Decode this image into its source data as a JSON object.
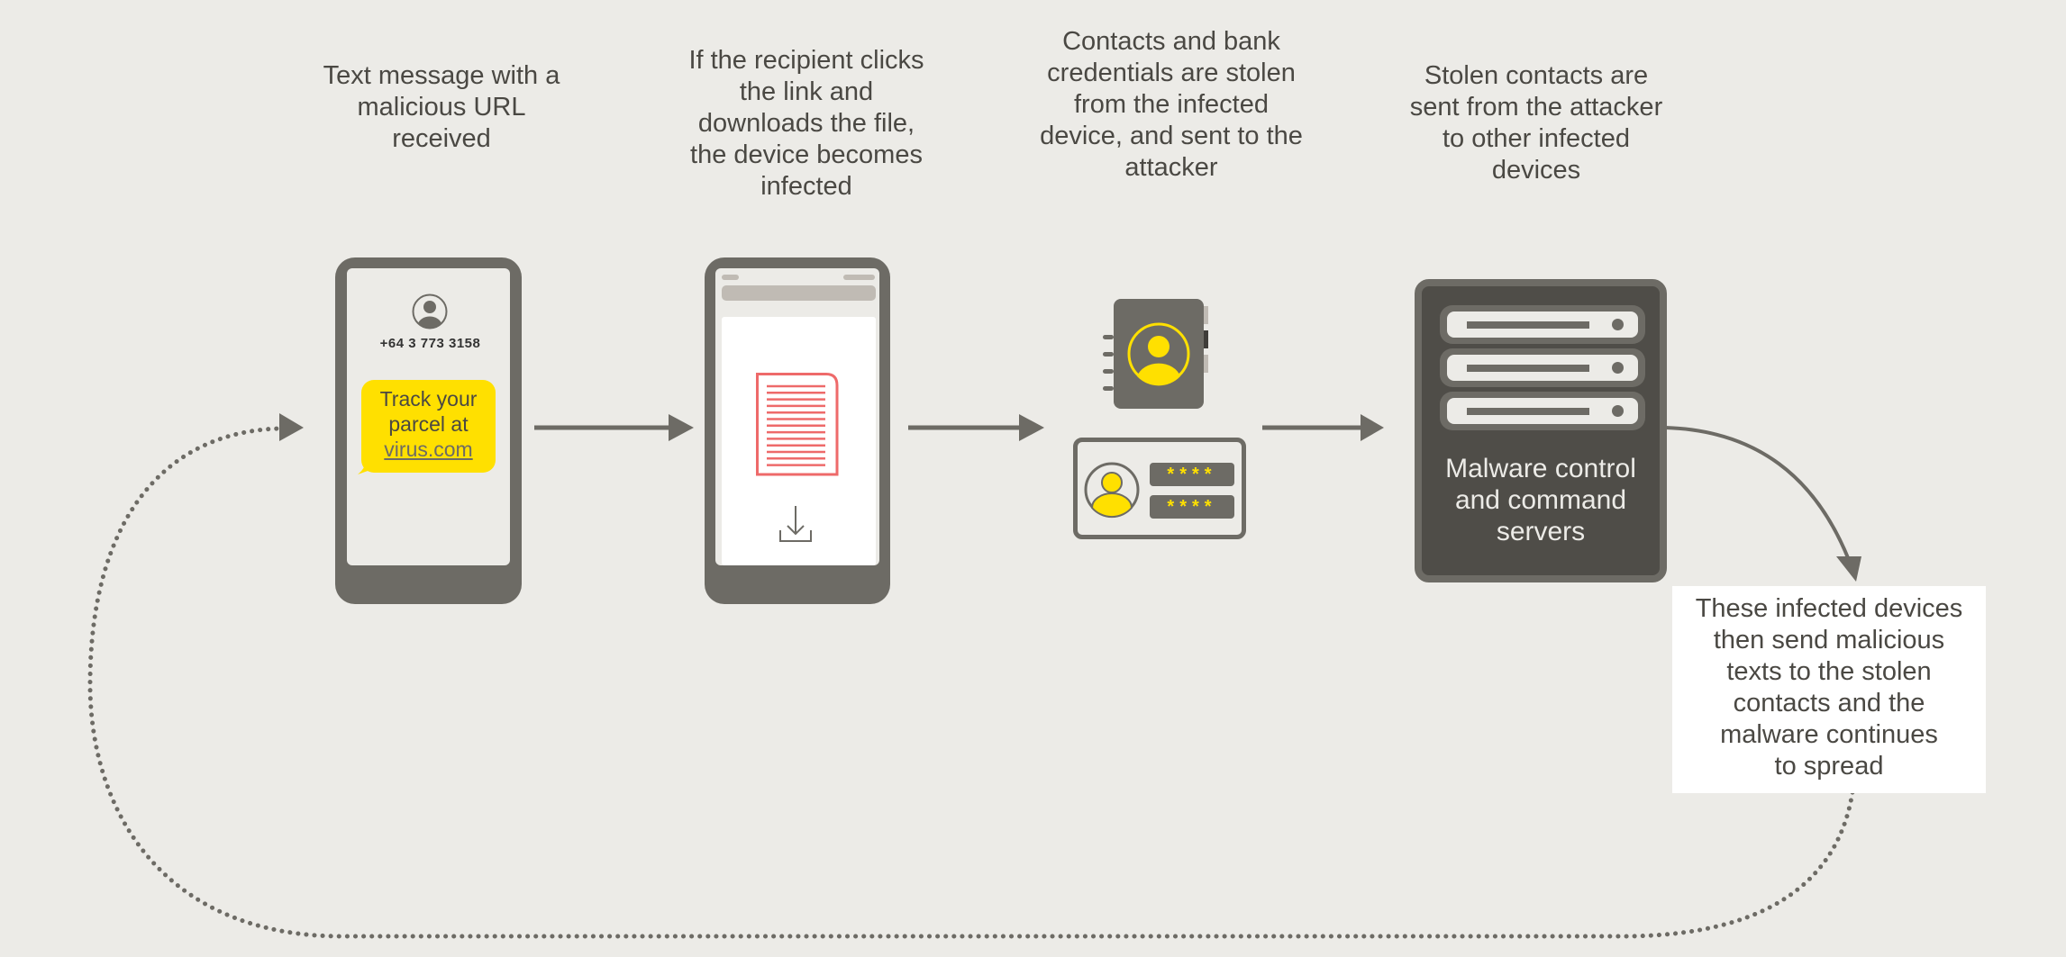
{
  "colors": {
    "background": "#ecebe7",
    "device_gray": "#6d6b65",
    "server_dark": "#4f4d48",
    "highlight_yellow": "#ffe000",
    "document_red": "#ee6a6a",
    "text": "#4a4843"
  },
  "steps": [
    {
      "caption": "Text message with a\nmalicious URL\nreceived"
    },
    {
      "caption": "If the recipient clicks\nthe link and\ndownloads the file,\nthe device becomes\ninfected"
    },
    {
      "caption": "Contacts and bank\ncredentials are stolen\nfrom the infected\ndevice, and sent to the\nattacker"
    },
    {
      "caption": "Stolen contacts are\nsent from the attacker\nto other infected\ndevices"
    }
  ],
  "sms_phone": {
    "sender_icon": "user-avatar-icon",
    "sender_number": "+64 3 773 3158",
    "message_line1": "Track your",
    "message_line2": "parcel at",
    "message_link": "virus.com"
  },
  "download_phone": {
    "file_icon": "document-icon",
    "action_icon": "download-icon"
  },
  "stolen_items": {
    "contacts_icon": "address-book-icon",
    "credentials_icon": "credentials-card-icon",
    "password_mask_1": "****",
    "password_mask_2": "****"
  },
  "server": {
    "icon": "server-rack-icon",
    "rack_count": 3,
    "label": "Malware control\nand command\nservers"
  },
  "outcome": {
    "text": "These infected devices\nthen send malicious\ntexts to the stolen\ncontacts and the\nmalware continues\nto spread"
  },
  "connectors": {
    "flow_arrows": [
      "arrow-right-icon",
      "arrow-right-icon",
      "arrow-right-icon"
    ],
    "curved_arrow": "curved-arrow-down-icon",
    "loop_arrow": "dotted-loop-arrow-icon"
  }
}
